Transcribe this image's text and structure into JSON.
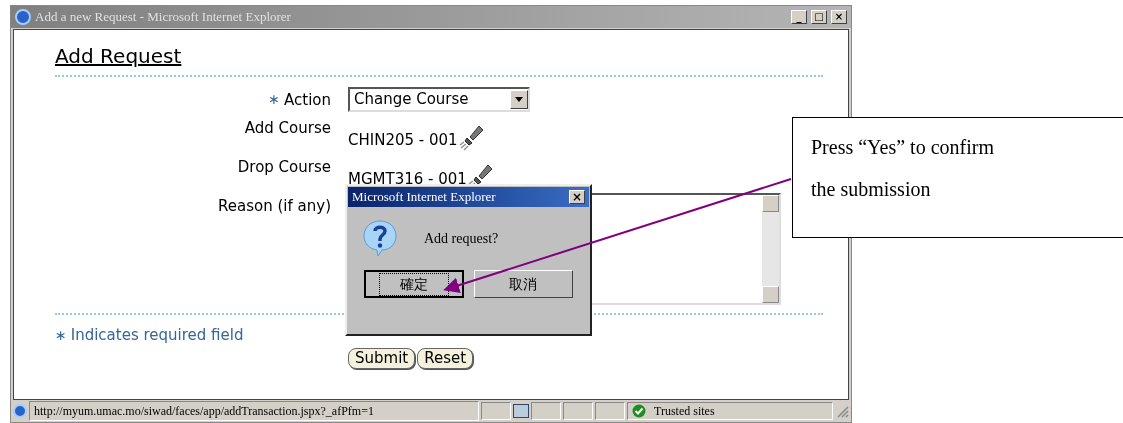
{
  "window": {
    "title": "Add a new Request - Microsoft Internet Explorer",
    "controls": [
      "_",
      "□",
      "×"
    ]
  },
  "page": {
    "heading": "Add Request",
    "fields": [
      {
        "kind": "select",
        "label": "Action",
        "required": true,
        "value": "Change Course"
      },
      {
        "kind": "lookup",
        "label": "Add Course",
        "required": false,
        "value": "CHIN205 - 001"
      },
      {
        "kind": "lookup",
        "label": "Drop Course",
        "required": false,
        "value": "MGMT316 - 001"
      },
      {
        "kind": "textarea",
        "label": "Reason (if any)",
        "required": false
      }
    ],
    "required_mark": "∗",
    "required_note": "Indicates required field",
    "buttons": [
      "Submit",
      "Reset"
    ]
  },
  "dialog": {
    "title": "Microsoft Internet Explorer",
    "close": "×",
    "message": "Add request?",
    "buttons": [
      {
        "label": "確定",
        "focused": true
      },
      {
        "label": "取消",
        "focused": false
      }
    ]
  },
  "status_bar": {
    "url": "http://myum.umac.mo/siwad/faces/app/addTransaction.jspx?_afPfm=1",
    "zone": "Trusted sites"
  },
  "callout": {
    "lines": [
      "Press “Yes” to confirm",
      "the submission"
    ]
  }
}
